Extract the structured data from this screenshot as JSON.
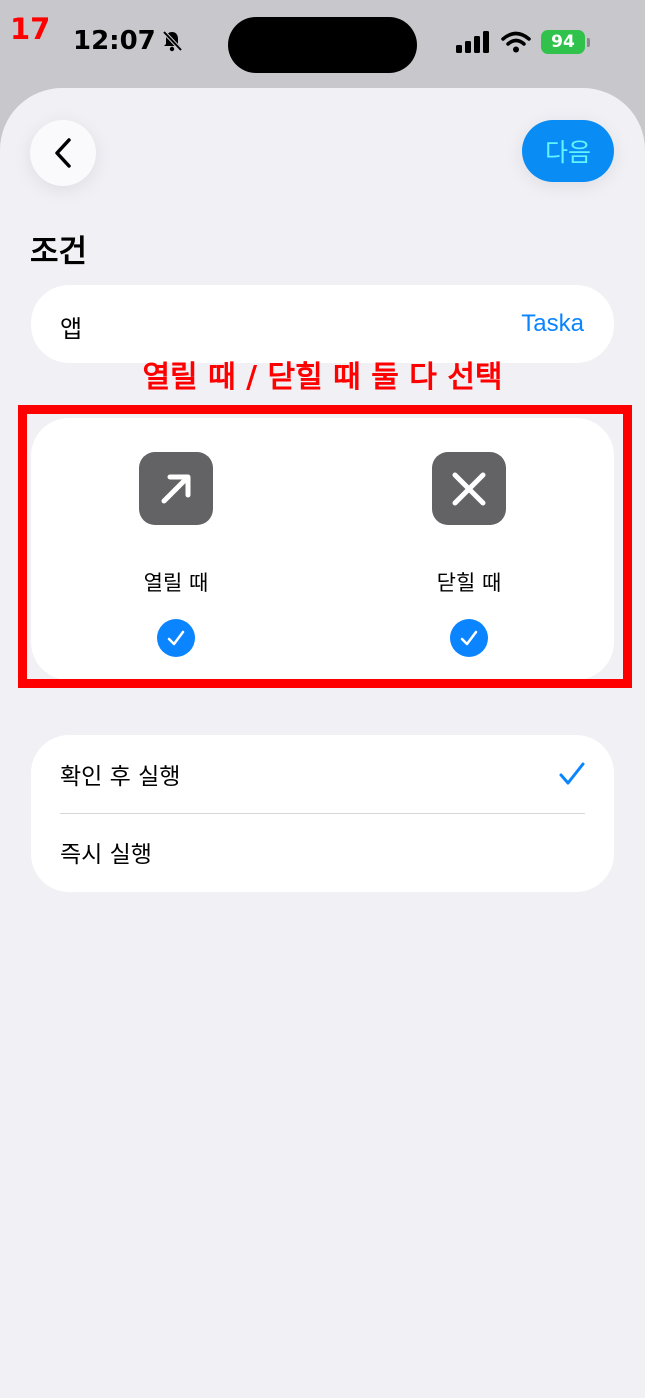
{
  "step_number": "17",
  "status_bar": {
    "time": "12:07",
    "battery": "94",
    "icons": [
      "bell-slash-icon",
      "signal-icon",
      "wifi-icon",
      "battery-icon"
    ]
  },
  "header": {
    "back_icon": "chevron-left-icon",
    "next_label": "다음"
  },
  "section_title": "조건",
  "app_row": {
    "label": "앱",
    "value": "Taska"
  },
  "annotation": "열릴 때 / 닫힐 때 둘 다 선택",
  "conditions": [
    {
      "icon": "arrow-up-right-icon",
      "label": "열릴 때",
      "checked": true
    },
    {
      "icon": "close-x-icon",
      "label": "닫힐 때",
      "checked": true
    }
  ],
  "run_options": [
    {
      "label": "확인 후 실행",
      "selected": true
    },
    {
      "label": "즉시 실행",
      "selected": false
    }
  ],
  "colors": {
    "accent": "#0a84ff",
    "annotation_red": "#ff0000",
    "icon_bg": "#636366",
    "background": "#f0f0f5"
  }
}
